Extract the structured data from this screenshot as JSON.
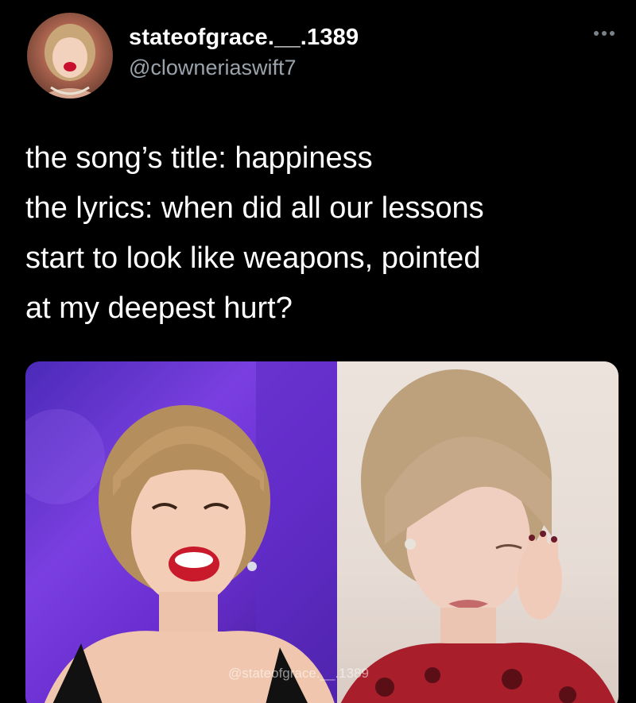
{
  "tweet": {
    "display_name": "stateofgrace.__.1389",
    "handle": "@clowneriaswift7",
    "more_icon": "more-horizontal-icon",
    "text_lines": [
      "the song’s title: happiness",
      "the lyrics: when did all our lessons",
      "start to look like weapons, pointed",
      "at my deepest hurt?"
    ]
  },
  "media": {
    "watermark": "@stateofgrace.__.1389",
    "left_image": "laughing-woman-photo",
    "right_image": "crying-woman-photo"
  },
  "colors": {
    "background": "#000000",
    "text": "#ffffff",
    "secondary_text": "#9aa3ab"
  }
}
